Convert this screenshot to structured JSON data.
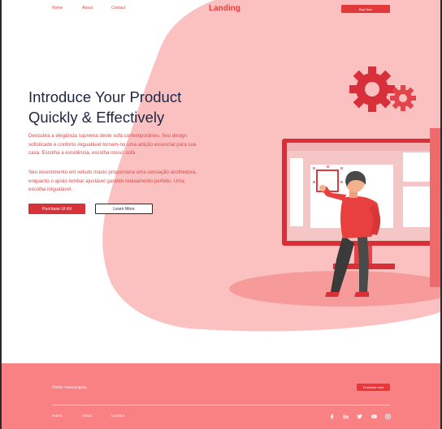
{
  "nav": {
    "logo": "Landing",
    "links": [
      "Home",
      "About",
      "Contact"
    ],
    "buy_now": "Buy Now"
  },
  "hero": {
    "headline_line1": "Introduce Your Product",
    "headline_line2": "Quickly & Effectively",
    "paragraph1": "Descubra a elegância suprema deste sofá contemporâneo. Seu design sofisticado e conforto inigualável tornam-no uma adição essencial para sua casa. Escolha a excelência, escolha nosso sofá.",
    "paragraph2": "Seu revestimento em veludo macio proporciona uma sensação acolhedora, enquanto o apoio lombar ajustável garante relaxamento perfeito. Uma escolha inigualável.",
    "primary_button": "Purchase UI Kit",
    "secondary_button": "Learn More"
  },
  "footer": {
    "copyright": "©2022 Yourcompany",
    "button": "Purchase now",
    "links": [
      "Home",
      "About",
      "Contact"
    ],
    "social_icons": [
      "facebook-icon",
      "linkedin-icon",
      "twitter-icon",
      "youtube-icon",
      "instagram-icon"
    ]
  },
  "colors": {
    "accent": "#e23a3a",
    "blob": "#fbc1c1",
    "footer": "#f98183",
    "headline": "#1f2540"
  }
}
